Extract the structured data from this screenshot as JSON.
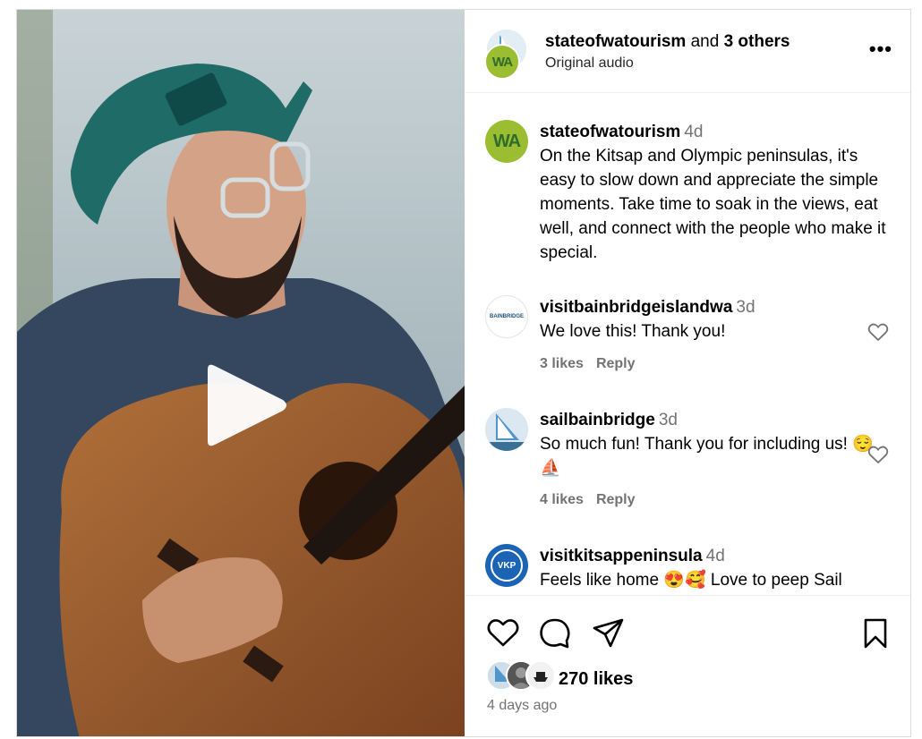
{
  "header": {
    "username": "stateofwatourism",
    "and_text": " and ",
    "others": "3 others",
    "audio": "Original audio",
    "more": "•••",
    "avatar_text": "WA"
  },
  "caption": {
    "username": "stateofwatourism",
    "time": "4d",
    "text": "On the Kitsap and Olympic peninsulas, it's easy to slow down and appreciate the simple moments. Take time to soak in the views, eat well, and connect with the people who make it special.",
    "avatar_text": "WA"
  },
  "comments": [
    {
      "username": "visitbainbridgeislandwa",
      "time": "3d",
      "text": "We love this! Thank you!",
      "likes": "3 likes",
      "reply": "Reply",
      "avatar_text": "BAINBRIDGE"
    },
    {
      "username": "sailbainbridge",
      "time": "3d",
      "text": "So much fun! Thank you for including us! 😌⛵",
      "likes": "4 likes",
      "reply": "Reply",
      "avatar_text": "Sail"
    },
    {
      "username": "visitkitsappeninsula",
      "time": "4d",
      "text": "Feels like home 😍🥰 Love to peep Sail Bainbridge and",
      "avatar_text": "VKP"
    }
  ],
  "footer": {
    "likes": "270 likes",
    "time_ago": "4 days ago"
  },
  "colors": {
    "muted": "#737373",
    "border": "#dbdbdb",
    "wa_green": "#9bbd32",
    "vkp_blue": "#1a63b5"
  }
}
